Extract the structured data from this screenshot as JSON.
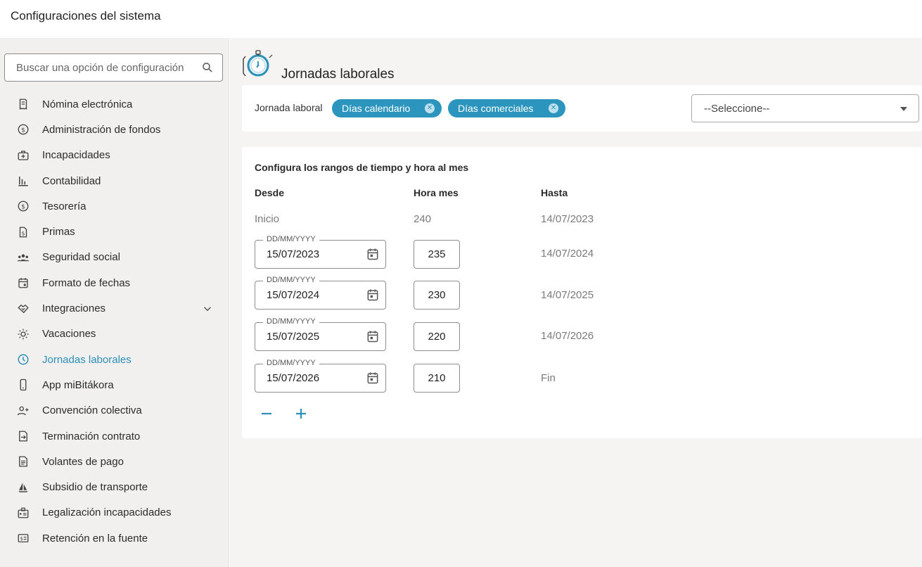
{
  "app": {
    "title": "Configuraciones del sistema"
  },
  "sidebar": {
    "search_placeholder": "Buscar una opción de configuración",
    "items": [
      {
        "label": "Nómina electrónica",
        "icon": "receipt-icon"
      },
      {
        "label": "Administración de fondos",
        "icon": "dollar-circle-icon"
      },
      {
        "label": "Incapacidades",
        "icon": "medical-kit-icon"
      },
      {
        "label": "Contabilidad",
        "icon": "bar-chart-icon"
      },
      {
        "label": "Tesorería",
        "icon": "dollar-circle-icon"
      },
      {
        "label": "Primas",
        "icon": "document-dollar-icon"
      },
      {
        "label": "Seguridad social",
        "icon": "group-icon"
      },
      {
        "label": "Formato de fechas",
        "icon": "calendar-icon"
      },
      {
        "label": "Integraciones",
        "icon": "handshake-icon"
      },
      {
        "label": "Vacaciones",
        "icon": "sun-icon"
      },
      {
        "label": "Jornadas laborales",
        "icon": "clock-icon"
      },
      {
        "label": "App miBitákora",
        "icon": "phone-icon"
      },
      {
        "label": "Convención colectiva",
        "icon": "person-add-icon"
      },
      {
        "label": "Terminación contrato",
        "icon": "contract-end-icon"
      },
      {
        "label": "Volantes de pago",
        "icon": "document-icon"
      },
      {
        "label": "Subsidio de transporte",
        "icon": "sailboat-icon"
      },
      {
        "label": "Legalización incapacidades",
        "icon": "badge-icon"
      },
      {
        "label": "Retención en la fuente",
        "icon": "cash-icon"
      }
    ],
    "active_index": 10
  },
  "page": {
    "title": "Jornadas laborales",
    "jornada_label": "Jornada laboral",
    "chips": [
      "Días calendario",
      "Días comerciales"
    ],
    "select_value": "--Seleccione--"
  },
  "ranges": {
    "title": "Configura los rangos de tiempo y hora al mes",
    "headers": {
      "desde": "Desde",
      "hora_mes": "Hora mes",
      "hasta": "Hasta"
    },
    "first_row": {
      "desde": "Inicio",
      "hora": "240",
      "hasta": "14/07/2023"
    },
    "date_label": "DD/MM/YYYY",
    "rows": [
      {
        "desde": "15/07/2023",
        "hora": "235",
        "hasta": "14/07/2024"
      },
      {
        "desde": "15/07/2024",
        "hora": "230",
        "hasta": "14/07/2025"
      },
      {
        "desde": "15/07/2025",
        "hora": "220",
        "hasta": "14/07/2026"
      },
      {
        "desde": "15/07/2026",
        "hora": "210",
        "hasta": "Fin"
      }
    ]
  },
  "colors": {
    "accent": "#2b95be",
    "active_text": "#2b8fb8"
  }
}
